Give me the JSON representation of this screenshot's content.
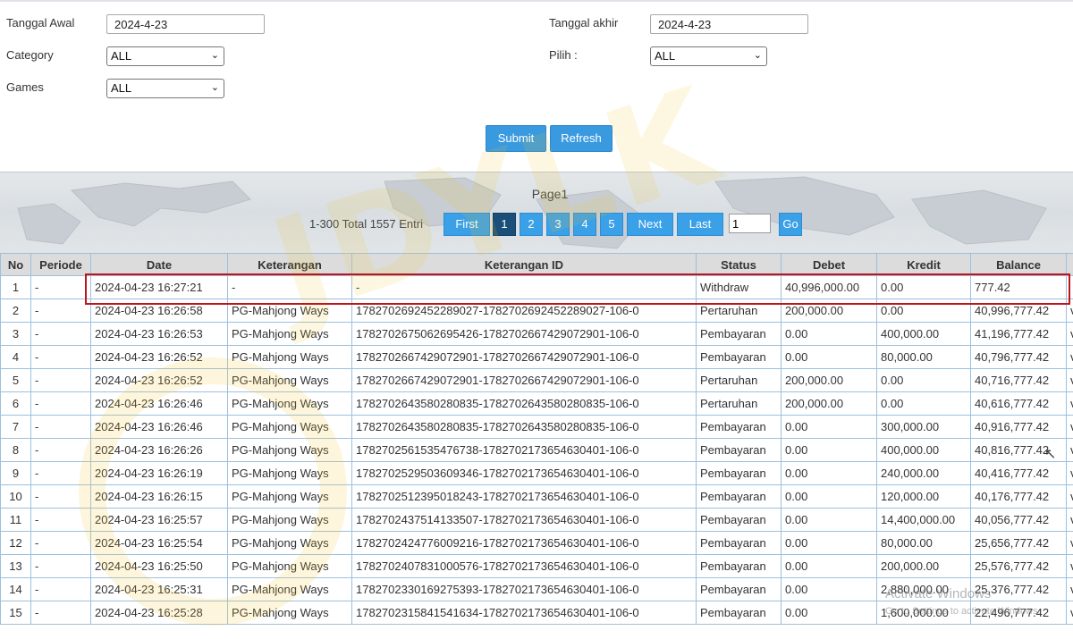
{
  "form": {
    "start_label": "Tanggal Awal",
    "start_value": "2024-4-23",
    "end_label": "Tanggal akhir",
    "end_value": "2024-4-23",
    "category_label": "Category",
    "category_value": "ALL",
    "pilih_label": "Pilih  :",
    "pilih_value": "ALL",
    "games_label": "Games",
    "games_value": "ALL",
    "submit_label": "Submit",
    "refresh_label": "Refresh"
  },
  "pager": {
    "title": "Page1",
    "info": "1-300 Total 1557 Entri",
    "first": "First",
    "pages": [
      "1",
      "2",
      "3",
      "4",
      "5"
    ],
    "next": "Next",
    "last": "Last",
    "page_input": "1",
    "go": "Go"
  },
  "table": {
    "headers": [
      "No",
      "Periode",
      "Date",
      "Keterangan",
      "Keterangan ID",
      "Status",
      "Debet",
      "Kredit",
      "Balance"
    ],
    "rows": [
      [
        "1",
        "-",
        "2024-04-23 16:27:21",
        "-",
        "-",
        "Withdraw",
        "40,996,000.00",
        "0.00",
        "777.42"
      ],
      [
        "2",
        "-",
        "2024-04-23 16:26:58",
        "PG-Mahjong Ways",
        "1782702692452289027-1782702692452289027-106-0",
        "Pertaruhan",
        "200,000.00",
        "0.00",
        "40,996,777.42"
      ],
      [
        "3",
        "-",
        "2024-04-23 16:26:53",
        "PG-Mahjong Ways",
        "1782702675062695426-1782702667429072901-106-0",
        "Pembayaran",
        "0.00",
        "400,000.00",
        "41,196,777.42"
      ],
      [
        "4",
        "-",
        "2024-04-23 16:26:52",
        "PG-Mahjong Ways",
        "1782702667429072901-1782702667429072901-106-0",
        "Pembayaran",
        "0.00",
        "80,000.00",
        "40,796,777.42"
      ],
      [
        "5",
        "-",
        "2024-04-23 16:26:52",
        "PG-Mahjong Ways",
        "1782702667429072901-1782702667429072901-106-0",
        "Pertaruhan",
        "200,000.00",
        "0.00",
        "40,716,777.42"
      ],
      [
        "6",
        "-",
        "2024-04-23 16:26:46",
        "PG-Mahjong Ways",
        "1782702643580280835-1782702643580280835-106-0",
        "Pertaruhan",
        "200,000.00",
        "0.00",
        "40,616,777.42"
      ],
      [
        "7",
        "-",
        "2024-04-23 16:26:46",
        "PG-Mahjong Ways",
        "1782702643580280835-1782702643580280835-106-0",
        "Pembayaran",
        "0.00",
        "300,000.00",
        "40,916,777.42"
      ],
      [
        "8",
        "-",
        "2024-04-23 16:26:26",
        "PG-Mahjong Ways",
        "1782702561535476738-1782702173654630401-106-0",
        "Pembayaran",
        "0.00",
        "400,000.00",
        "40,816,777.42"
      ],
      [
        "9",
        "-",
        "2024-04-23 16:26:19",
        "PG-Mahjong Ways",
        "1782702529503609346-1782702173654630401-106-0",
        "Pembayaran",
        "0.00",
        "240,000.00",
        "40,416,777.42"
      ],
      [
        "10",
        "-",
        "2024-04-23 16:26:15",
        "PG-Mahjong Ways",
        "1782702512395018243-1782702173654630401-106-0",
        "Pembayaran",
        "0.00",
        "120,000.00",
        "40,176,777.42"
      ],
      [
        "11",
        "-",
        "2024-04-23 16:25:57",
        "PG-Mahjong Ways",
        "1782702437514133507-1782702173654630401-106-0",
        "Pembayaran",
        "0.00",
        "14,400,000.00",
        "40,056,777.42"
      ],
      [
        "12",
        "-",
        "2024-04-23 16:25:54",
        "PG-Mahjong Ways",
        "1782702424776009216-1782702173654630401-106-0",
        "Pembayaran",
        "0.00",
        "80,000.00",
        "25,656,777.42"
      ],
      [
        "13",
        "-",
        "2024-04-23 16:25:50",
        "PG-Mahjong Ways",
        "1782702407831000576-1782702173654630401-106-0",
        "Pembayaran",
        "0.00",
        "200,000.00",
        "25,576,777.42"
      ],
      [
        "14",
        "-",
        "2024-04-23 16:25:31",
        "PG-Mahjong Ways",
        "1782702330169275393-1782702173654630401-106-0",
        "Pembayaran",
        "0.00",
        "2,880,000.00",
        "25,376,777.42"
      ],
      [
        "15",
        "-",
        "2024-04-23 16:25:28",
        "PG-Mahjong Ways",
        "1782702315841541634-1782702173654630401-106-0",
        "Pembayaran",
        "0.00",
        "1,600,000.00",
        "22,496,777.42"
      ]
    ],
    "extra_col_marker": "v"
  },
  "watermark_text": "JDYLK",
  "os_overlay": {
    "line1": "Activate Windows",
    "line2": "Go to Settings to activate Windows."
  },
  "colors": {
    "button_blue": "#3a9ae0",
    "active_page": "#1a4f7a",
    "highlight_red": "#c0141c",
    "withdraw_red": "#c0392b"
  }
}
